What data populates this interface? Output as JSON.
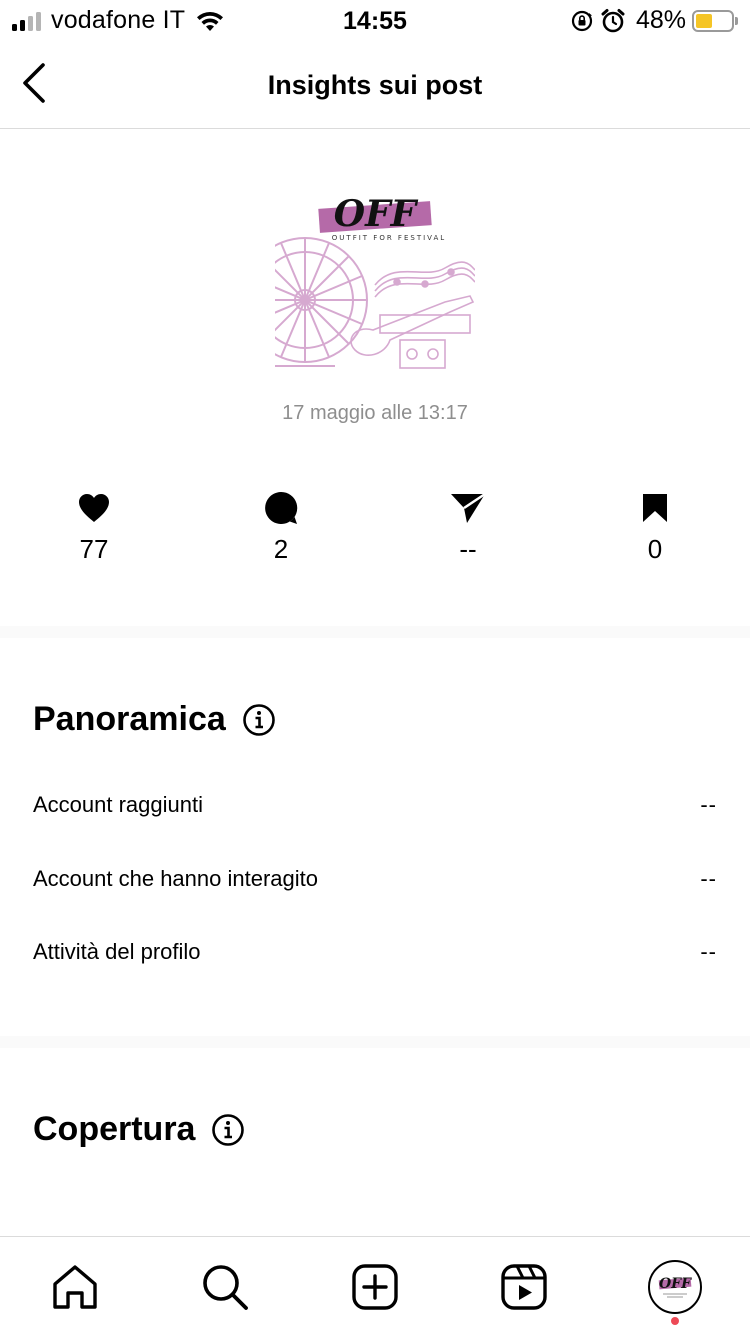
{
  "status_bar": {
    "carrier": "vodafone IT",
    "time": "14:55",
    "battery_percent": "48%",
    "battery_level": 0.48,
    "signal_bars_active": 2,
    "signal_bars_total": 4
  },
  "header": {
    "title": "Insights sui post"
  },
  "post": {
    "date": "17 maggio alle 13:17",
    "logo_text": "OFF",
    "logo_subtitle": "OUTFIT FOR FESTIVAL"
  },
  "stats": {
    "likes": "77",
    "comments": "2",
    "shares": "--",
    "saves": "0"
  },
  "overview": {
    "title": "Panoramica",
    "rows": [
      {
        "label": "Account raggiunti",
        "value": "--"
      },
      {
        "label": "Account che hanno interagito",
        "value": "--"
      },
      {
        "label": "Attività del profilo",
        "value": "--"
      }
    ]
  },
  "reach": {
    "title": "Copertura",
    "value": "--"
  },
  "colors": {
    "brand_pink": "#b56aa8",
    "notification_red": "#ed4956",
    "battery_yellow": "#f5c526",
    "muted_text": "#8e8e8e"
  },
  "tab_bar": {
    "icons": [
      "home-icon",
      "search-icon",
      "create-icon",
      "reels-icon",
      "profile-avatar"
    ]
  }
}
